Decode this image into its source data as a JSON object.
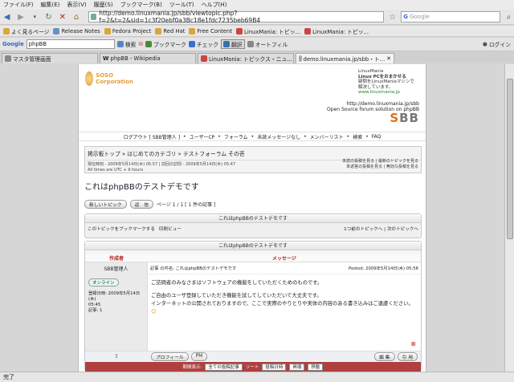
{
  "menu": [
    "ファイル(F)",
    "編集(E)",
    "表示(V)",
    "履歴(S)",
    "ブックマーク(B)",
    "ツール(T)",
    "ヘルプ(H)"
  ],
  "nav": {
    "url": "http://demo.linuxmania.jp/sbb/viewtopic.php?f=2&t=2&sid=1c3f20ebf0a3Bc18e1fdc7235beb69B4",
    "search_placeholder": "Google"
  },
  "bookmarks": [
    "よく見るページ",
    "Release Notes",
    "Fedora Project",
    "Red Hat",
    "Free Content",
    "LinuxMania: トピッ...",
    "LinuxMania: トピッ..."
  ],
  "toolbar": {
    "engine": "Google",
    "query": "phpBB",
    "items": [
      "検索",
      "ブックマーク",
      "チェック",
      "翻訳",
      "オートフィル"
    ],
    "login": "ログイン"
  },
  "tabs": [
    "マスタ管理画面",
    "phpBB - Wikipedia",
    "LinuxMania: トピックス・ニュ...",
    "demo.linuxmania.jp/sbb・ト..."
  ],
  "header": {
    "logo": "SOSO Corporation",
    "lm_lines": [
      "LinuxMania",
      "Linux PCをおまかせる",
      "疑問をLinuxManiaマシンで",
      "解決しています。",
      "www.linuxmania.jp"
    ],
    "url_line": "http://demo.linuxmania.jp/sbb",
    "tagline": "Open Source forum solution on phpBB",
    "sbb_s": "S",
    "sbb_bb": "BB"
  },
  "topnav": [
    "ログアウト [ SBB管理人 ]",
    "ユーザーCP",
    "フォーラム",
    "未読メッセージなし",
    "メンバーリスト",
    "検索",
    "FAQ"
  ],
  "breadcrumb": {
    "title": "掲示板トップ » はじめてのカテゴリ » テストフォーラム その壱",
    "line1": "現在時刻 - 2009年5月14日(木) 05:57 | 前回の訪問 - 2009年5月14日(木) 05:47",
    "line2": "All times are UTC + 9 hours",
    "r1": "未読の投稿を見る | 最新のトピックを見る",
    "r2": "未返答の投稿を見る | 無効な投稿を見る"
  },
  "topic_title": "これはphpBBのテストデモです",
  "controls": {
    "new_topic": "新しいトピック",
    "reply": "返　信",
    "pages": "ページ 1 / 1 [ 1 件の記事 ]"
  },
  "box1": {
    "title": "これはphpBBのテストデモです",
    "bookmark": "このトピックをブックマークする",
    "print": "印刷ビュー",
    "nav": "1つ前のトピックへ | 次のトピックへ"
  },
  "post": {
    "header": "これはphpBBのテストデモです",
    "col_author": "作成者",
    "col_message": "メッセージ",
    "author": "SBB管理人",
    "online": "オンライン",
    "joined": "登録日時: 2009年5月14日(木)",
    "time": "05:45",
    "posts": "記事: 1",
    "subject": "記事 の件名: これはphpBBのテストデモです",
    "posted": "Posted: 2009年5月14日(木) 05:56",
    "body1": "ご訪問者のみなさまはソフトウェアの機能をしていただくためのものです。",
    "body2": "ご自由のユーザ登録していただき機能を試してしていただいて大丈夫です。",
    "body3": "インターネットの公開されておりますので、ここで実際のやりとりや実体の内容のある書き込みはご遠慮ください。",
    "profile": "プロフィール",
    "pm": "PM",
    "quote": "編 集",
    "del": "引 用"
  },
  "sortbar": {
    "label": "期間表示:",
    "period": "全ての投稿記事",
    "sort_label": "ソート",
    "sort": "投稿日時",
    "order": "昇順",
    "go": "移動"
  },
  "status": "完了"
}
